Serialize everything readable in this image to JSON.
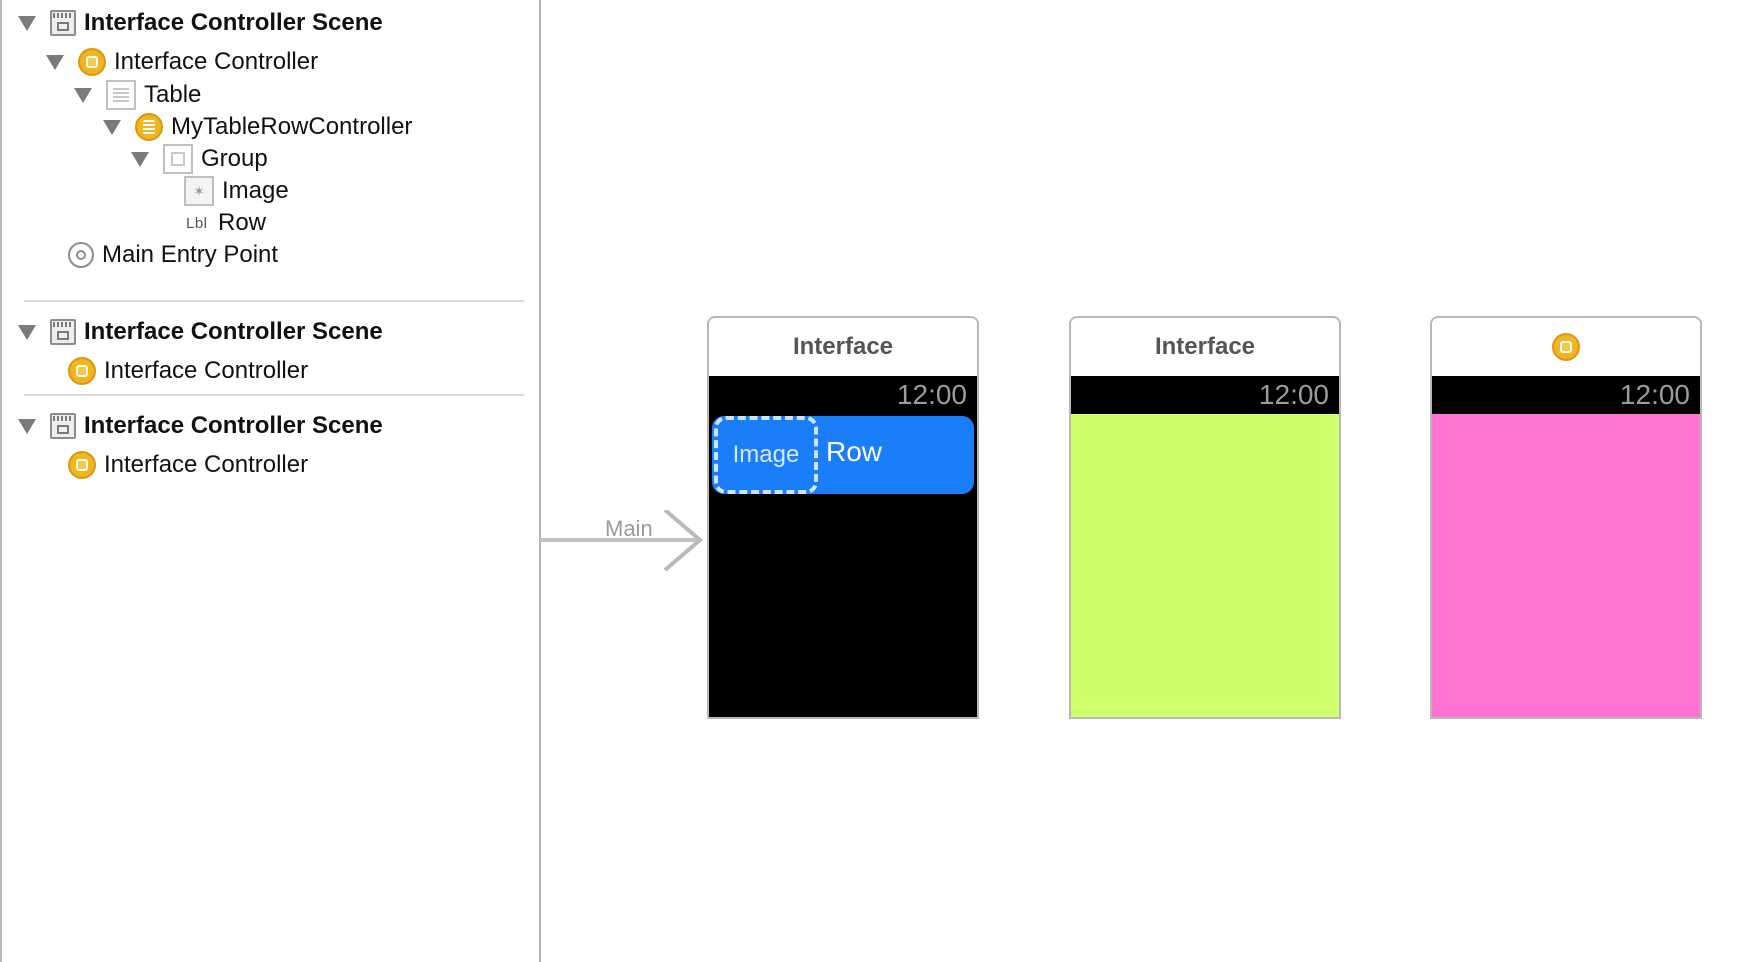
{
  "outline": {
    "scenes": [
      {
        "title": "Interface Controller Scene",
        "controller": "Interface Controller",
        "table": "Table",
        "row_controller": "MyTableRowController",
        "group": "Group",
        "image": "Image",
        "label_type": "Lbl",
        "label": "Row",
        "entry_point": "Main Entry Point"
      },
      {
        "title": "Interface Controller Scene",
        "controller": "Interface Controller"
      },
      {
        "title": "Interface Controller Scene",
        "controller": "Interface Controller"
      }
    ]
  },
  "canvas": {
    "entry_label": "Main",
    "controllers": [
      {
        "title": "Interface",
        "time": "12:00",
        "background": "#000000",
        "row": {
          "image_placeholder": "Image",
          "label": "Row",
          "color": "#1a7ef9"
        }
      },
      {
        "title": "Interface",
        "time": "12:00",
        "background": "#d0ff6c"
      },
      {
        "title_icon": "interface-controller-icon",
        "time": "12:00",
        "background": "#ff74d0"
      }
    ]
  },
  "colors": {
    "controller_icon": "#f3b51c",
    "row_blue": "#1a7ef9",
    "lime": "#d0ff6c",
    "pink": "#ff74d0"
  }
}
